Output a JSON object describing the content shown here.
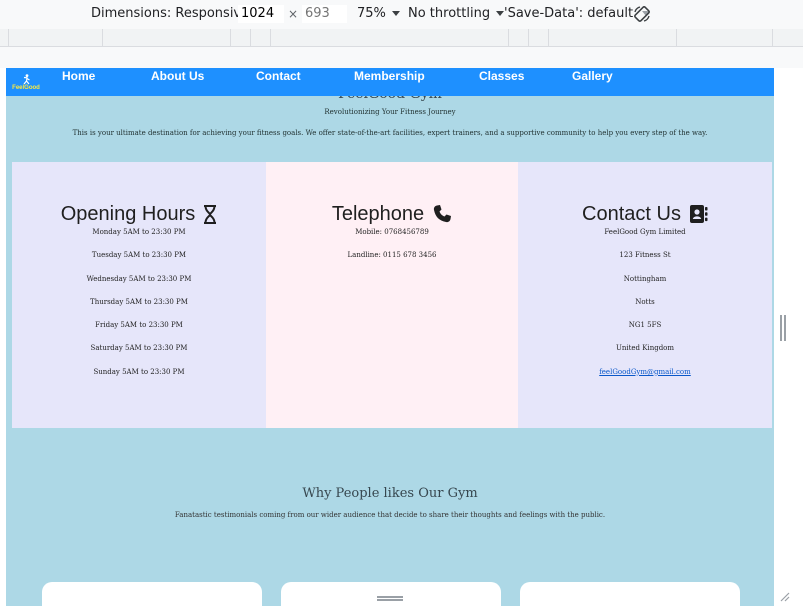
{
  "devtools": {
    "dimensions_label": "Dimensions: Responsive",
    "width": "1024",
    "height_placeholder": "693",
    "times": "×",
    "zoom": "75%",
    "throttling": "No throttling",
    "save_data": "'Save-Data': default"
  },
  "nav": {
    "brand": "FeelGood",
    "links": [
      "Home",
      "About Us",
      "Contact",
      "Membership",
      "Classes",
      "Gallery"
    ]
  },
  "hero": {
    "title": "FeelGood Gym",
    "subtitle": "Revolutionizing Your Fitness Journey",
    "description": "This is your ultimate destination for achieving your fitness goals. We offer state-of-the-art facilities, expert trainers, and a supportive community to help you every step of the way."
  },
  "cards": [
    {
      "title": "Opening Hours",
      "icon": "hourglass-icon",
      "bg": "#e6e6fa",
      "lines": [
        "Monday 5AM to 23:30 PM",
        "Tuesday 5AM to 23:30 PM",
        "Wednesday 5AM to 23:30 PM",
        "Thursday 5AM to 23:30 PM",
        "Friday 5AM to 23:30 PM",
        "Saturday 5AM to 23:30 PM",
        "Sunday 5AM to 23:30 PM"
      ]
    },
    {
      "title": "Telephone",
      "icon": "phone-icon",
      "bg": "#fff0f5",
      "lines": [
        "Mobile: 0768456789",
        "Landline: 0115 678 3456"
      ]
    },
    {
      "title": "Contact Us",
      "icon": "address-book-icon",
      "bg": "#e6e6fa",
      "lines": [
        "FeelGood Gym Limited",
        "123 Fitness St",
        "Nottingham",
        "Notts",
        "NG1 5FS",
        "United Kingdom"
      ],
      "email": "feelGoodGym@gmail.com"
    }
  ],
  "testimonials": {
    "title": "Why People likes Our Gym",
    "subtitle": "Fanatastic testimonials coming from our wider audience that decide to share their thoughts and feelings with the public."
  },
  "colors": {
    "nav_bg": "#1e90ff",
    "page_bg": "#add8e6",
    "link": "#0a58ca"
  }
}
